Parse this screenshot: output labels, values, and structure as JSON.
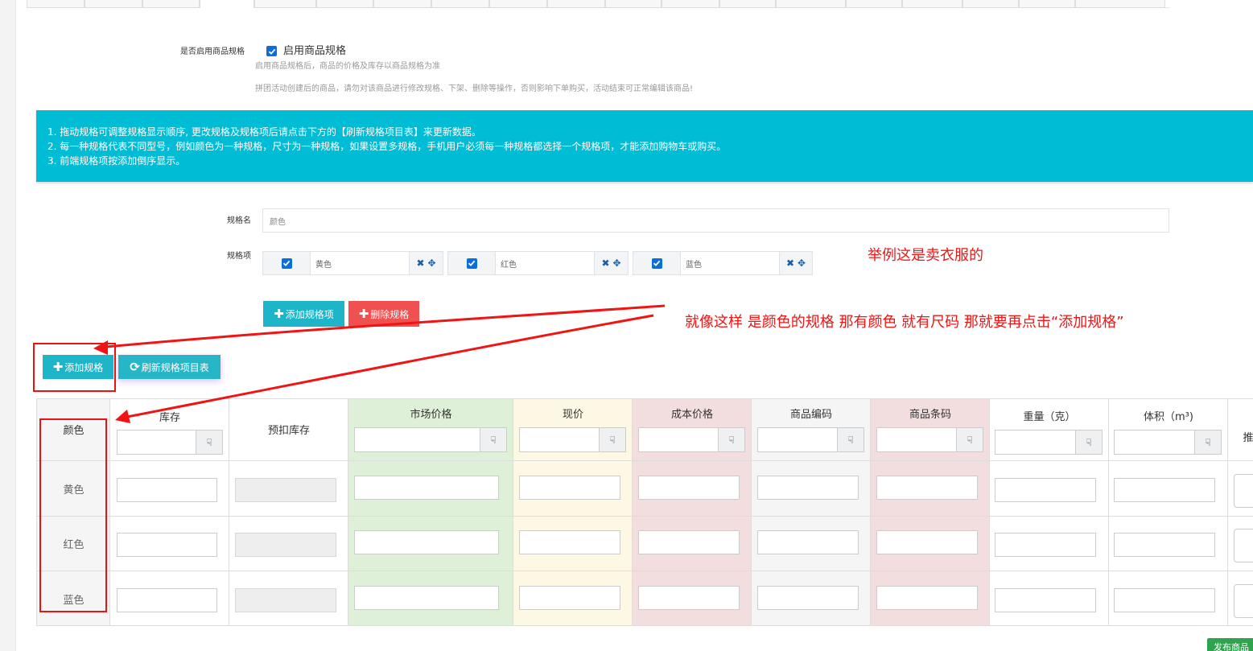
{
  "spec_toggle": {
    "label": "是否启用商品规格",
    "checkbox_label": "启用商品规格",
    "hint_1": "启用商品规格后，商品的价格及库存以商品规格为准",
    "hint_2": "拼团活动创建后的商品，请勿对该商品进行修改规格、下架、删除等操作，否则影响下单购买，活动结束可正常编辑该商品!"
  },
  "info_box": {
    "line_1": "1. 拖动规格可调整规格显示顺序, 更改规格及规格项后请点击下方的【刷新规格项目表】来更新数据。",
    "line_2": "2. 每一种规格代表不同型号，例如颜色为一种规格，尺寸为一种规格，如果设置多规格，手机用户必须每一种规格都选择一个规格项，才能添加购物车或购买。",
    "line_3": "3. 前端规格项按添加倒序显示。",
    "color": "#00bcd4"
  },
  "spec_form": {
    "name_label": "规格名",
    "name_placeholder": "颜色",
    "items_label": "规格项",
    "items": [
      {
        "value": "黄色",
        "checked": true
      },
      {
        "value": "红色",
        "checked": true
      },
      {
        "value": "蓝色",
        "checked": true
      }
    ],
    "add_item_button": "添加规格项",
    "delete_spec_button": "删除规格"
  },
  "toolbar": {
    "add_spec_button": "添加规格",
    "refresh_button": "刷新规格项目表"
  },
  "annotations": {
    "note_1": "举例这是卖衣服的",
    "note_2": "就像这样 是颜色的规格  那有颜色 就有尺码 那就要再点击“添加规格”",
    "color": "#f01414"
  },
  "table": {
    "headers": {
      "spec": "颜色",
      "stock": "库存",
      "reserved_stock": "预扣库存",
      "market_price": "市场价格",
      "current_price": "现价",
      "cost_price": "成本价格",
      "product_code": "商品编码",
      "barcode": "商品条码",
      "weight": "重量（克）",
      "volume": "体积（m³)",
      "recommend": "推"
    },
    "rows": [
      "黄色",
      "红色",
      "蓝色"
    ],
    "colors": {
      "market_price": "#dff0d8",
      "current_price": "#fcf8e3",
      "cost_price": "#f2dede",
      "product_code": "#f5f5f5",
      "barcode": "#f2dede",
      "spec_column": "#f5f5f5"
    }
  },
  "footer": {
    "publish_button": "发布商品"
  }
}
